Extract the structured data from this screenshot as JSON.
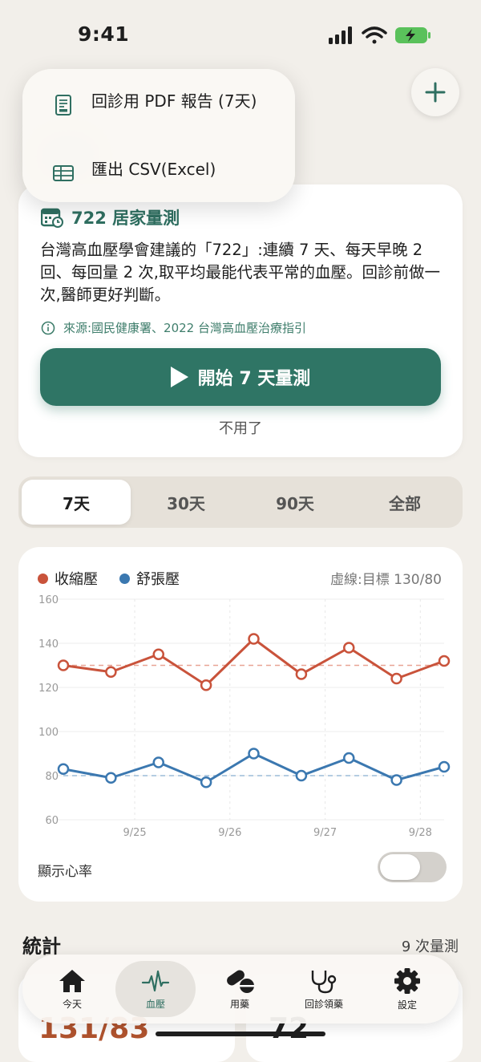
{
  "status": {
    "time": "9:41"
  },
  "menu": {
    "pdf_label": "回診用 PDF 報告 (7天)",
    "csv_label": "匯出 CSV(Excel)"
  },
  "card722": {
    "title": "722 居家量測",
    "body": "台灣高血壓學會建議的「722」:連續 7 天、每天早晚 2 回、每回量 2 次,取平均最能代表平常的血壓。回診前做一次,醫師更好判斷。",
    "source": "來源:國民健康署、2022 台灣高血壓治療指引",
    "start_button": "開始 7 天量測",
    "dismiss": "不用了"
  },
  "tabs": [
    "7天",
    "30天",
    "90天",
    "全部"
  ],
  "chart_header": {
    "legend_systolic": "收縮壓",
    "legend_diastolic": "舒張壓",
    "target_note": "虛線:目標 130/80"
  },
  "colors": {
    "systolic": "#c9533b",
    "diastolic": "#3b78b0",
    "accent": "#2f7565"
  },
  "chart_data": {
    "type": "line",
    "x": [
      1,
      2,
      3,
      4,
      5,
      6,
      7,
      8,
      9
    ],
    "x_tick_labels": [
      "9/25",
      "9/26",
      "9/27",
      "9/28"
    ],
    "y_ticks": [
      160,
      140,
      120,
      100,
      80,
      60
    ],
    "ylim": [
      60,
      160
    ],
    "series": [
      {
        "name": "收縮壓",
        "values": [
          130,
          127,
          135,
          121,
          142,
          126,
          138,
          124,
          132
        ]
      },
      {
        "name": "舒張壓",
        "values": [
          83,
          79,
          86,
          77,
          90,
          80,
          88,
          78,
          84
        ]
      }
    ],
    "targets": {
      "systolic": 130,
      "diastolic": 80
    },
    "grid": true
  },
  "heart_rate": {
    "label": "顯示心率",
    "enabled": false
  },
  "stats": {
    "title": "統計",
    "count": "9 次量測",
    "bp_avg": "131/83",
    "hr_avg": "72"
  },
  "tabbar": {
    "items": [
      {
        "label": "今天",
        "icon": "home-icon"
      },
      {
        "label": "血壓",
        "icon": "pulse-icon"
      },
      {
        "label": "用藥",
        "icon": "pill-icon"
      },
      {
        "label": "回診領藥",
        "icon": "stethoscope-icon"
      },
      {
        "label": "設定",
        "icon": "gear-icon"
      }
    ]
  }
}
